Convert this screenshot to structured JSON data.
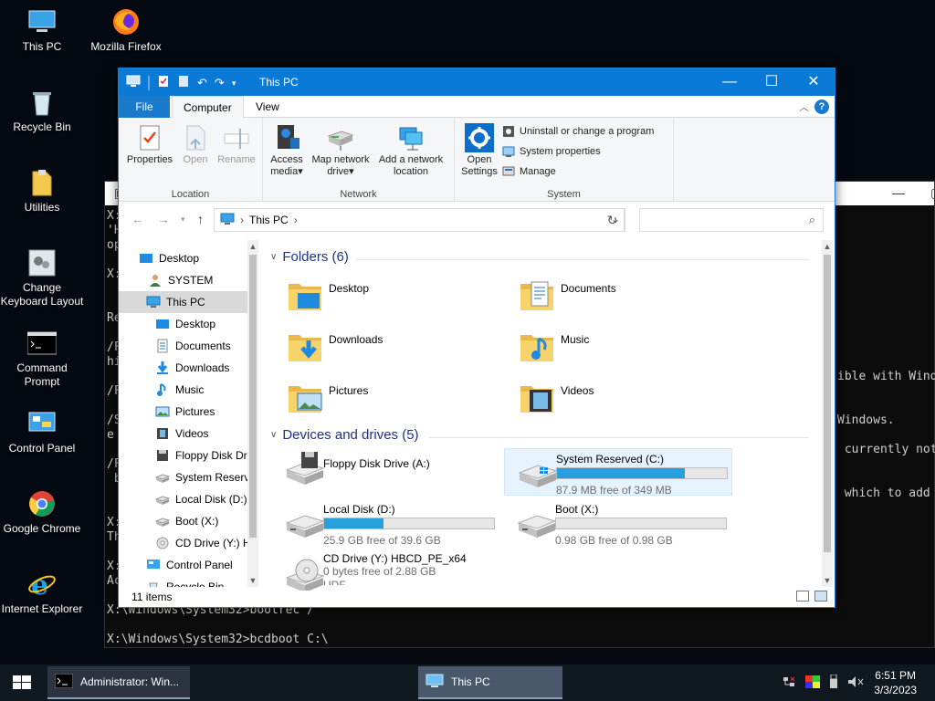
{
  "desktop": {
    "icons": [
      {
        "label": "This PC"
      },
      {
        "label": "Mozilla Firefox"
      },
      {
        "label": "Recycle Bin"
      },
      {
        "label": "Utilities"
      },
      {
        "label": "Change Keyboard Layout"
      },
      {
        "label": "Command Prompt"
      },
      {
        "label": "Control Panel"
      },
      {
        "label": "Google Chrome"
      },
      {
        "label": "Internet Explorer"
      }
    ]
  },
  "console": {
    "lines": [
      "X:",
      "'H",
      "op",
      "",
      "X:",
      "",
      "",
      "Re",
      "",
      "/F",
      "hi",
      "",
      "/F",
      "",
      "/S",
      "e",
      "",
      "/F",
      " b",
      "",
      "",
      "X:",
      "Th",
      "",
      "X:",
      "Ac",
      "",
      "X:\\Windows\\System32>bootrec /",
      "",
      "X:\\Windows\\System32>bcdboot C:\\"
    ],
    "right_lines": [
      {
        "text": "ible with Wind",
        "row": 11
      },
      {
        "text": "Windows.",
        "row": 14
      },
      {
        "text": " currently not",
        "row": 16
      },
      {
        "text": " which to add",
        "row": 19
      }
    ]
  },
  "explorer": {
    "title": "This PC",
    "tabs": {
      "file": "File",
      "computer": "Computer",
      "view": "View"
    },
    "help": "?",
    "ribbon": {
      "location": {
        "label": "Location",
        "properties": "Properties",
        "open": "Open",
        "rename": "Rename"
      },
      "network": {
        "label": "Network",
        "access_media": "Access media",
        "map_drive": "Map network drive",
        "add_location": "Add a network location"
      },
      "system": {
        "label": "System",
        "open_settings": "Open Settings",
        "uninstall": "Uninstall or change a program",
        "system_properties": "System properties",
        "manage": "Manage"
      }
    },
    "address": {
      "path": "This PC"
    },
    "nav": [
      {
        "label": "Desktop",
        "indent": 0
      },
      {
        "label": "SYSTEM",
        "indent": 1
      },
      {
        "label": "This PC",
        "indent": 1,
        "selected": true
      },
      {
        "label": "Desktop",
        "indent": 2
      },
      {
        "label": "Documents",
        "indent": 2
      },
      {
        "label": "Downloads",
        "indent": 2
      },
      {
        "label": "Music",
        "indent": 2
      },
      {
        "label": "Pictures",
        "indent": 2
      },
      {
        "label": "Videos",
        "indent": 2
      },
      {
        "label": "Floppy Disk Dri",
        "indent": 2
      },
      {
        "label": "System Reserve",
        "indent": 2
      },
      {
        "label": "Local Disk (D:)",
        "indent": 2
      },
      {
        "label": "Boot (X:)",
        "indent": 2
      },
      {
        "label": "CD Drive (Y:) H",
        "indent": 2
      },
      {
        "label": "Control Panel",
        "indent": 1
      },
      {
        "label": "Recycle Bin",
        "indent": 1
      }
    ],
    "folders_header": "Folders (6)",
    "folders": [
      {
        "name": "Desktop"
      },
      {
        "name": "Documents"
      },
      {
        "name": "Downloads"
      },
      {
        "name": "Music"
      },
      {
        "name": "Pictures"
      },
      {
        "name": "Videos"
      }
    ],
    "drives_header": "Devices and drives (5)",
    "drives": [
      {
        "name": "Floppy Disk Drive (A:)",
        "free": "",
        "used_fraction": null
      },
      {
        "name": "System Reserved (C:)",
        "free": "87.9 MB free of 349 MB",
        "used_fraction": 0.75
      },
      {
        "name": "Local Disk (D:)",
        "free": "25.9 GB free of 39.6 GB",
        "used_fraction": 0.35
      },
      {
        "name": "Boot (X:)",
        "free": "0.98 GB free of 0.98 GB",
        "used_fraction": 0.0
      },
      {
        "name": "CD Drive (Y:) HBCD_PE_x64",
        "free": "0 bytes free of 2.88 GB",
        "used_fraction": null
      },
      {
        "name_tail": "UDF"
      }
    ],
    "status": "11 items"
  },
  "taskbar": {
    "cmd_task": "Administrator: Win...",
    "pc_task": "This PC",
    "time": "6:51 PM",
    "date": "3/3/2023"
  }
}
